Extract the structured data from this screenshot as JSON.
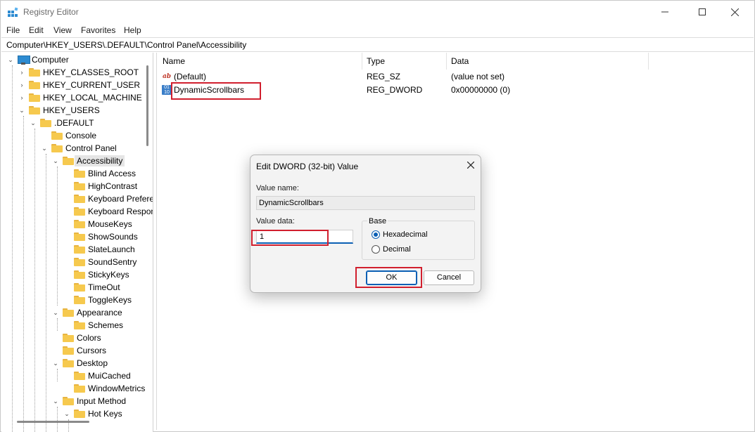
{
  "window": {
    "title": "Registry Editor",
    "icons": {
      "app": "registry-editor-icon",
      "minimize": "minimize-icon",
      "maximize": "maximize-icon",
      "close": "close-icon"
    }
  },
  "menu": [
    "File",
    "Edit",
    "View",
    "Favorites",
    "Help"
  ],
  "address": "Computer\\HKEY_USERS\\.DEFAULT\\Control Panel\\Accessibility",
  "tree": {
    "root": "Computer",
    "items": [
      "HKEY_CLASSES_ROOT",
      "HKEY_CURRENT_USER",
      "HKEY_LOCAL_MACHINE",
      "HKEY_USERS",
      ".DEFAULT",
      "Console",
      "Control Panel",
      "Accessibility",
      "Blind Access",
      "HighContrast",
      "Keyboard Preference",
      "Keyboard Response",
      "MouseKeys",
      "ShowSounds",
      "SlateLaunch",
      "SoundSentry",
      "StickyKeys",
      "TimeOut",
      "ToggleKeys",
      "Appearance",
      "Schemes",
      "Colors",
      "Cursors",
      "Desktop",
      "MuiCached",
      "WindowMetrics",
      "Input Method",
      "Hot Keys"
    ],
    "selected": "Accessibility"
  },
  "list": {
    "columns": [
      "Name",
      "Type",
      "Data"
    ],
    "rows": [
      {
        "name": "(Default)",
        "type": "REG_SZ",
        "data": "(value not set)",
        "icon": "string-value-icon"
      },
      {
        "name": "DynamicScrollbars",
        "type": "REG_DWORD",
        "data": "0x00000000 (0)",
        "icon": "dword-value-icon"
      }
    ]
  },
  "dialog": {
    "title": "Edit DWORD (32-bit) Value",
    "value_name_label": "Value name:",
    "value_name": "DynamicScrollbars",
    "value_data_label": "Value data:",
    "value_data": "1",
    "base_label": "Base",
    "base_options": [
      "Hexadecimal",
      "Decimal"
    ],
    "base_selected": "Hexadecimal",
    "ok_label": "OK",
    "cancel_label": "Cancel"
  },
  "colors": {
    "highlight": "#d11f2e",
    "accent": "#0a5fb4",
    "folder": "#f6c94e"
  }
}
